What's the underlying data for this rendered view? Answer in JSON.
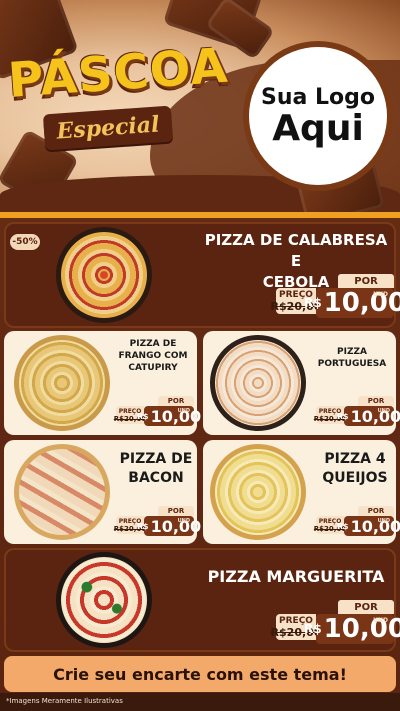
{
  "header": {
    "title": "PÁSCOA",
    "subtitle": "Especial",
    "logo_line1": "Sua Logo",
    "logo_line2": "Aqui"
  },
  "discount_badge": "-50%",
  "products": [
    {
      "name_line1": "PIZZA DE CALABRESA E",
      "name_line2": "CEBOLA",
      "por": "POR",
      "preco_label": "PREÇO",
      "old_price": "R$20,00",
      "currency": "R$",
      "price": "10,00",
      "unit": "UND"
    },
    {
      "name_line1": "PIZZA DE",
      "name_line2": "FRANGO COM",
      "name_line3": "CATUPIRY",
      "por": "POR",
      "preco_label": "PREÇO",
      "old_price": "R$20,00",
      "currency": "R$",
      "price": "10,00",
      "unit": "UND"
    },
    {
      "name_line1": "PIZZA",
      "name_line2": "PORTUGUESA",
      "por": "POR",
      "preco_label": "PREÇO",
      "old_price": "R$20,00",
      "currency": "R$",
      "price": "10,00",
      "unit": "UND"
    },
    {
      "name_line1": "PIZZA DE",
      "name_line2": "BACON",
      "por": "POR",
      "preco_label": "PREÇO",
      "old_price": "R$20,00",
      "currency": "R$",
      "price": "10,00",
      "unit": "UND"
    },
    {
      "name_line1": "PIZZA 4",
      "name_line2": "QUEIJOS",
      "por": "POR",
      "preco_label": "PREÇO",
      "old_price": "R$20,00",
      "currency": "R$",
      "price": "10,00",
      "unit": "UND"
    },
    {
      "name_line1": "PIZZA MARGUERITA",
      "por": "POR",
      "preco_label": "PREÇO",
      "old_price": "R$20,00",
      "currency": "R$",
      "price": "10,00",
      "unit": "UND"
    }
  ],
  "cta": "Crie seu encarte com este tema!",
  "disclaimer": "*Imagens Meramente Ilustrativas",
  "colors": {
    "brown": "#5a2410",
    "cream": "#fbf0dd",
    "gold": "#f6c31c",
    "cta": "#f2a96a"
  }
}
